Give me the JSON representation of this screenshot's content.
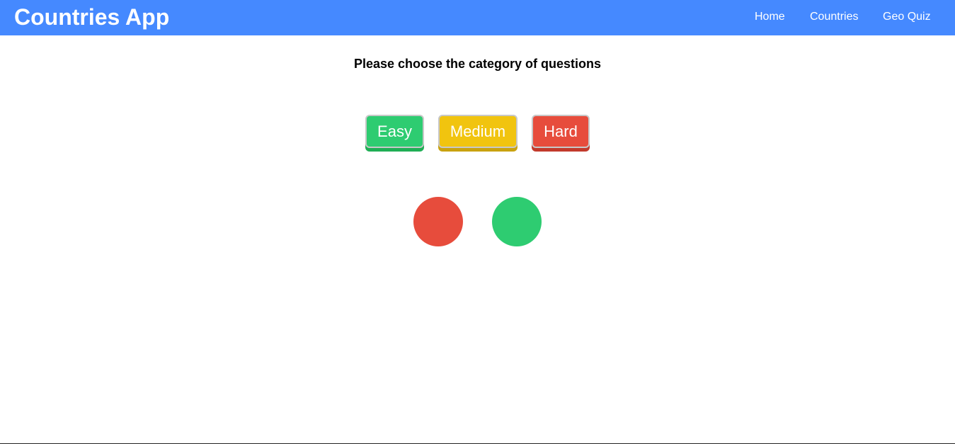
{
  "header": {
    "title": "Countries App",
    "nav": [
      {
        "label": "Home"
      },
      {
        "label": "Countries"
      },
      {
        "label": "Geo Quiz"
      }
    ],
    "bg_color": "#4589ff"
  },
  "main": {
    "prompt": "Please choose the category of questions",
    "categories": [
      {
        "label": "Easy",
        "color": "#2ecc71"
      },
      {
        "label": "Medium",
        "color": "#f1c40f"
      },
      {
        "label": "Hard",
        "color": "#e74c3c"
      }
    ],
    "indicators": [
      {
        "color": "#e74c3c"
      },
      {
        "color": "#2ecc71"
      }
    ]
  }
}
